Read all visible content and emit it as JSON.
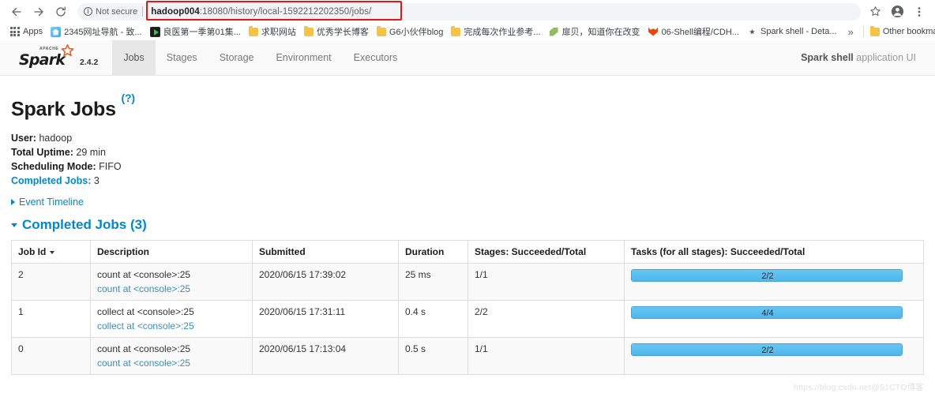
{
  "browser": {
    "back_icon": "back-arrow-icon",
    "forward_icon": "forward-arrow-icon",
    "reload_icon": "reload-icon",
    "security_label": "Not secure",
    "url_host": "hadoop004",
    "url_rest": ":18080/history/local-1592212202350/jobs/",
    "url_full": "hadoop004:18080/history/local-1592212202350/jobs/",
    "url_highlight_color": "#ee1111",
    "star_icon": "bookmark-star-icon",
    "profile_icon": "profile-avatar-icon",
    "menu_icon": "three-dot-menu-icon"
  },
  "bookmarks": {
    "apps_label": "Apps",
    "overflow_label": "»",
    "items": [
      {
        "label": "2345网址导航 - 致...",
        "icon": "home-favicon"
      },
      {
        "label": "良医第一季第01集...",
        "icon": "video-favicon"
      },
      {
        "label": "求职网站",
        "icon": "folder-icon"
      },
      {
        "label": "优秀学长博客",
        "icon": "folder-icon"
      },
      {
        "label": "G6小伙伴blog",
        "icon": "folder-icon"
      },
      {
        "label": "完成每次作业参考...",
        "icon": "folder-icon"
      },
      {
        "label": "扉贝，知道你在改变",
        "icon": "leaf-favicon"
      },
      {
        "label": "06-Shell编程/CDH...",
        "icon": "fox-favicon"
      },
      {
        "label": "Spark shell - Deta...",
        "icon": "spark-favicon"
      }
    ],
    "other_bookmarks": {
      "label": "Other bookmarks",
      "icon": "folder-icon"
    }
  },
  "spark_nav": {
    "brand": "Spark",
    "brand_apache": "APACHE",
    "version": "2.4.2",
    "tabs": [
      {
        "label": "Jobs",
        "active": true
      },
      {
        "label": "Stages",
        "active": false
      },
      {
        "label": "Storage",
        "active": false
      },
      {
        "label": "Environment",
        "active": false
      },
      {
        "label": "Executors",
        "active": false
      }
    ],
    "app_name": "Spark shell",
    "app_suffix": " application UI"
  },
  "page": {
    "title": "Spark Jobs",
    "help_link": "(?)",
    "user_label": "User:",
    "user_value": "hadoop",
    "uptime_label": "Total Uptime:",
    "uptime_value": "29 min",
    "scheduling_label": "Scheduling Mode:",
    "scheduling_value": "FIFO",
    "completed_label": "Completed Jobs:",
    "completed_value": "3",
    "event_timeline_label": "Event Timeline",
    "completed_section_label": "Completed Jobs (3)"
  },
  "table": {
    "headers": [
      "Job Id",
      "Description",
      "Submitted",
      "Duration",
      "Stages: Succeeded/Total",
      "Tasks (for all stages): Succeeded/Total"
    ],
    "rows": [
      {
        "job_id": "2",
        "description": "count at <console>:25",
        "description_link": "count at <console>:25",
        "submitted": "2020/06/15 17:39:02",
        "duration": "25 ms",
        "stages": "1/1",
        "tasks": "2/2",
        "tasks_percent": 100
      },
      {
        "job_id": "1",
        "description": "collect at <console>:25",
        "description_link": "collect at <console>:25",
        "submitted": "2020/06/15 17:31:11",
        "duration": "0.4 s",
        "stages": "2/2",
        "tasks": "4/4",
        "tasks_percent": 100
      },
      {
        "job_id": "0",
        "description": "count at <console>:25",
        "description_link": "count at <console>:25",
        "submitted": "2020/06/15 17:13:04",
        "duration": "0.5 s",
        "stages": "1/1",
        "tasks": "2/2",
        "tasks_percent": 100
      }
    ]
  },
  "watermark": "https://blog.csdn.net@51CTO博客",
  "colors": {
    "link": "#0088cc",
    "progress_fill": "#5bbdef",
    "progress_border": "#4aa3d4",
    "active_tab_bg": "#e7e7e7"
  }
}
